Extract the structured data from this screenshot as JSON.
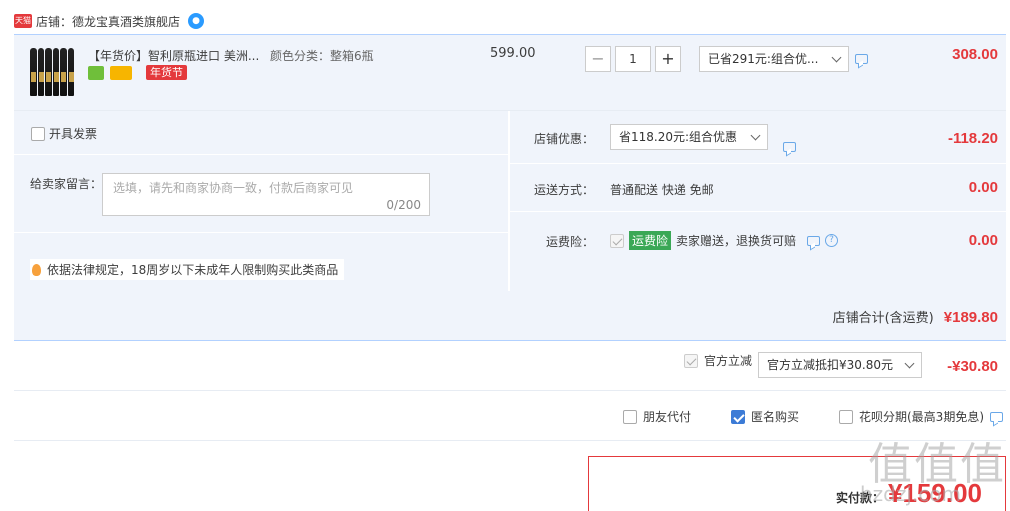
{
  "shop": {
    "badge": "天猫",
    "label": "店铺：德龙宝真酒类旗舰店"
  },
  "item": {
    "title": "【年货价】智利原瓶进口 美洲...",
    "sku": "颜色分类：整箱6瓶",
    "festival_tag": "年货节",
    "unit_price": "599.00",
    "quantity": "1",
    "promo_select": "已省291元:组合优...",
    "subtotal": "308.00"
  },
  "invoice": {
    "label": "开具发票"
  },
  "message": {
    "label": "给卖家留言：",
    "placeholder": "选填，请先和商家协商一致，付款后商家可见",
    "counter": "0/200"
  },
  "notice": "依据法律规定，18周岁以下未成年人限制购买此类商品",
  "shop_discount": {
    "label": "店铺优惠：",
    "select": "省118.20元:组合优惠",
    "amount": "-118.20"
  },
  "delivery": {
    "label": "运送方式：",
    "value": "普通配送 快递 免邮",
    "amount": "0.00"
  },
  "freight_insurance": {
    "label": "运费险：",
    "badge": "运费险",
    "value": "卖家赠送，退换货可赔",
    "amount": "0.00"
  },
  "shop_total": {
    "label": "店铺合计(含运费)",
    "amount": "¥189.80"
  },
  "official_discount": {
    "label": "官方立减",
    "select": "官方立减抵扣¥30.80元",
    "amount": "-¥30.80"
  },
  "options": {
    "friend_pay": "朋友代付",
    "anonymous": "匿名购买",
    "huabei": "花呗分期(最高3期免息)"
  },
  "final": {
    "label": "实付款：",
    "amount": "¥159.00"
  },
  "watermark": {
    "text": "值值值",
    "url": "hzdzj.com"
  }
}
